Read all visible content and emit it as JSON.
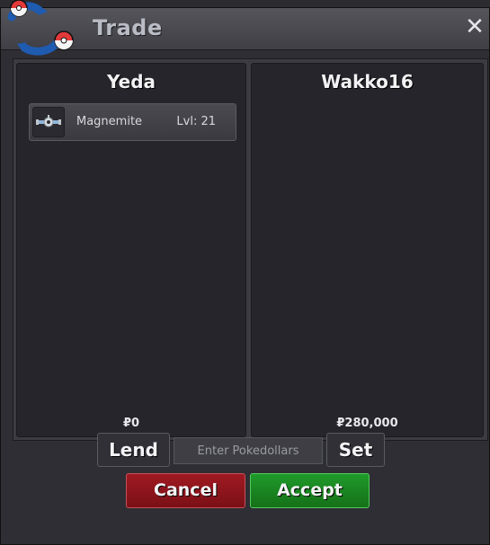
{
  "window": {
    "title": "Trade",
    "close_label": "✕"
  },
  "left_panel": {
    "player_name": "Yeda",
    "items": [
      {
        "name": "Magnemite",
        "level": "Lvl: 21",
        "icon": "magnemite-icon"
      }
    ],
    "money": "₽0"
  },
  "right_panel": {
    "player_name": "Wakko16",
    "money": "₽280,000"
  },
  "controls": {
    "lend_label": "Lend",
    "money_placeholder": "Enter Pokedollars",
    "set_label": "Set",
    "cancel_label": "Cancel",
    "accept_label": "Accept"
  },
  "colors": {
    "cancel": "#8d1520",
    "accept": "#1b8a22"
  }
}
